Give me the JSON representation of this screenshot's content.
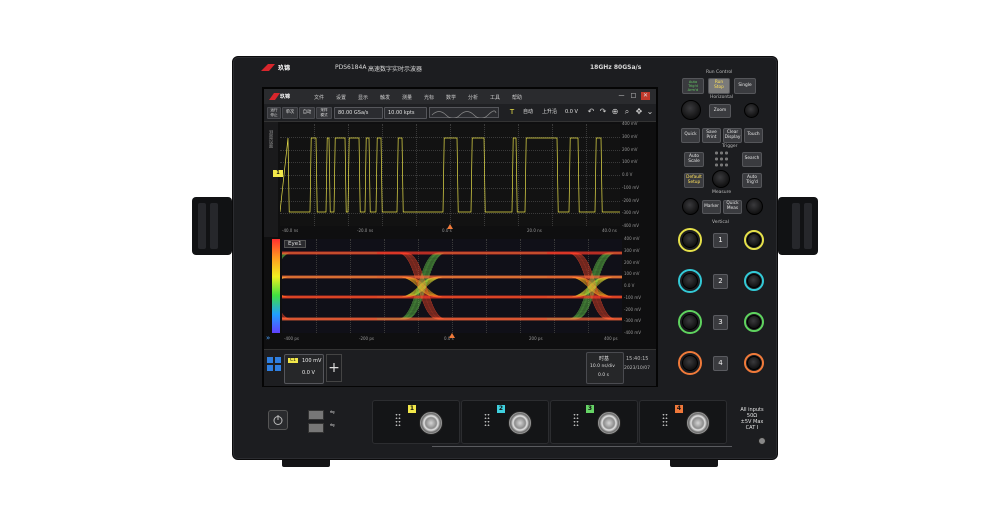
{
  "header": {
    "brand": "玖锦",
    "model": "PDS6184A",
    "title": "高速数字实时示波器",
    "spec": "18GHz  80GSa/s"
  },
  "menu": [
    "文件",
    "设置",
    "显示",
    "触发",
    "测量",
    "光标",
    "数学",
    "分析",
    "工具",
    "帮助"
  ],
  "window_controls": [
    "—",
    "□",
    "✕"
  ],
  "toolbar": {
    "btn_run_stop": "运行\n停止",
    "btn_single": "单次",
    "btn_auto": "自动",
    "btn_acq": "采样\n模式",
    "sample_rate": "80.00 GSa/s",
    "memory_depth": "10.00 kpts",
    "trigger_mode": "自动",
    "trigger_edge": "上升沿",
    "trigger_level": "0.0 V",
    "icons": [
      "undo-icon",
      "redo-icon",
      "zoom-icon",
      "search-icon",
      "move-icon",
      "chevron-down-icon"
    ]
  },
  "waveform": {
    "side_label": "测量设置",
    "marker": "1",
    "y_ticks": [
      "400 mV",
      "300 mV",
      "200 mV",
      "100 mV",
      "0.0 V",
      "-100 mV",
      "-200 mV",
      "-300 mV",
      "-400 mV"
    ],
    "x_ticks": [
      "-40.0 ns",
      "-20.0 ns",
      "0.0 s",
      "20.0 ns",
      "40.0 ns"
    ]
  },
  "eye": {
    "title": "Eye1",
    "y_ticks": [
      "400 mV",
      "300 mV",
      "200 mV",
      "100 mV",
      "0.0 V",
      "-100 mV",
      "-200 mV",
      "-300 mV",
      "-400 mV"
    ],
    "x_ticks": [
      "-400 ps",
      "-200 ps",
      "0.0 s",
      "200 ps",
      "400 ps"
    ]
  },
  "bottom": {
    "ch_label": "C1",
    "ch_scale": "100 mV",
    "ch_offset": "0.0 V",
    "add": "+",
    "timebase_title": "时基",
    "timebase_scale": "10.0 ns/div",
    "timebase_offset": "0.0 s",
    "clock_time": "15:40:15",
    "clock_date": "2023/10/07"
  },
  "panel": {
    "run_control_title": "Run Control",
    "btn_auto_trig": "Auto\nTrig'd\nArm'd",
    "btn_run_stop": "Run\nStop",
    "btn_single": "Single",
    "horizontal_title": "Horizontal",
    "btn_zoom": "Zoom",
    "btn_quick": "Quick",
    "btn_save_print": "Save\nPrint",
    "btn_clear_display": "Clear\nDisplay",
    "btn_touch": "Touch",
    "trigger_title": "Trigger",
    "btn_autoscale": "Auto\nScale",
    "btn_search": "Search",
    "btn_default_setup": "Default\nSetup",
    "btn_auto_trig2": "Auto\nTrig'd",
    "measure_title": "Measure",
    "btn_marker": "Marker",
    "btn_quick_meas": "Quick\nMeas",
    "vertical_title": "Vertical",
    "channels": [
      "1",
      "2",
      "3",
      "4"
    ],
    "ring_colors": [
      "#e5e04a",
      "#33c9d6",
      "#5fd35f",
      "#f07a3a"
    ]
  },
  "front": {
    "channel_tags": [
      "1",
      "2",
      "3",
      "4"
    ],
    "tag_colors": [
      "#f2e84a",
      "#3fd0de",
      "#66d466",
      "#f0783a"
    ],
    "input_rating": "All inputs\n50Ω\n±5V Max\nCAT I"
  }
}
